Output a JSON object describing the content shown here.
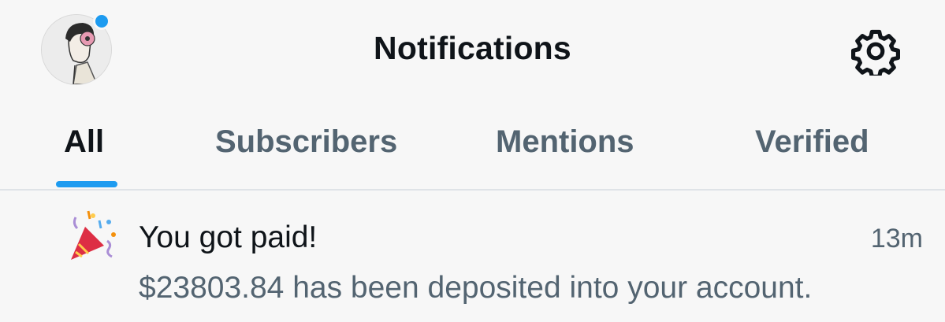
{
  "header": {
    "title": "Notifications",
    "avatar_icon": "user-avatar",
    "unread_dot_color": "#1d9bf0",
    "settings_icon": "gear-icon"
  },
  "tabs": [
    {
      "label": "All",
      "active": true
    },
    {
      "label": "Subscribers",
      "active": false
    },
    {
      "label": "Mentions",
      "active": false
    },
    {
      "label": "Verified",
      "active": false
    }
  ],
  "accent_color": "#1d9bf0",
  "notifications": [
    {
      "icon": "party-popper-icon",
      "title": "You got paid!",
      "time": "13m",
      "body": "$23803.84 has been deposited into your account."
    }
  ]
}
